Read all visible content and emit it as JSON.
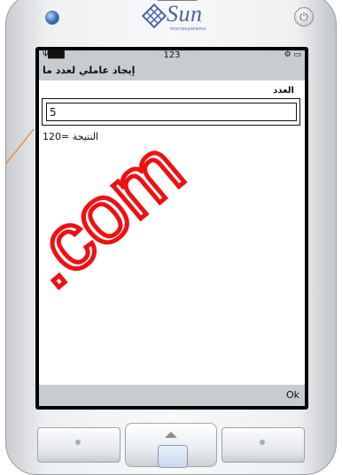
{
  "device": {
    "brand": "Sun",
    "brand_sub": "microsystems",
    "power_symbol": "⏻"
  },
  "status": {
    "signal": "Ψ███",
    "time": "123",
    "icons": "⚙ ▭"
  },
  "app": {
    "title": "إيجاد عاملي لعدد ما",
    "number_label": "العدد",
    "number_value": "5",
    "result_text": "النتيجة =120"
  },
  "softkeys": {
    "right": "Ok"
  },
  "watermark": {
    "text": ".com",
    "color": "#ee1111"
  }
}
